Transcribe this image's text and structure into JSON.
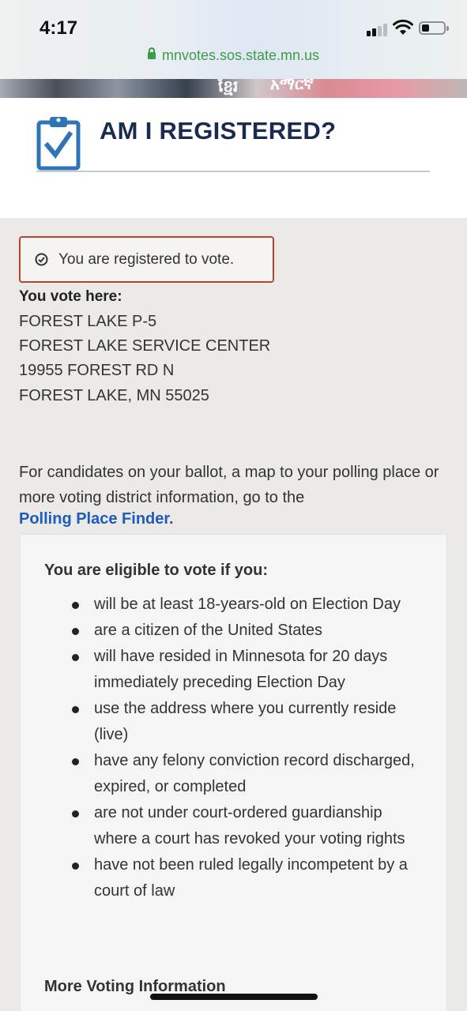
{
  "status_bar": {
    "time": "4:17",
    "url": "mnvotes.sos.state.mn.us"
  },
  "language_strip": {
    "items": [
      "ខ្មែរ",
      "አማርኛ"
    ]
  },
  "header": {
    "title": "AM I REGISTERED?"
  },
  "alert": {
    "message": "You are registered to vote."
  },
  "polling_place": {
    "label": "You vote here:",
    "lines": [
      "FOREST LAKE P-5",
      "FOREST LAKE SERVICE CENTER",
      "19955 FOREST RD N",
      "FOREST LAKE, MN 55025"
    ]
  },
  "info": {
    "text": "For candidates on your ballot, a map to your polling place or more voting district information, go to the",
    "link": "Polling Place Finder."
  },
  "eligibility": {
    "heading": "You are eligible to vote if you:",
    "items": [
      "will be at least 18-years-old on Election Day",
      "are a citizen of the United States",
      "will have resided in Minnesota for 20 days immediately preceding Election Day",
      "use the address where you currently reside (live)",
      "have any felony conviction record discharged, expired, or completed",
      "are not under court-ordered guardianship where a court has revoked your voting rights",
      "have not been ruled legally incompetent by a court of law"
    ],
    "more_heading": "More Voting Information"
  },
  "colors": {
    "title_navy": "#1b2b4f",
    "link_blue": "#1d5bbf",
    "alert_border": "#b5452f",
    "url_green": "#3c9c47",
    "icon_blue": "#2f73b8"
  }
}
